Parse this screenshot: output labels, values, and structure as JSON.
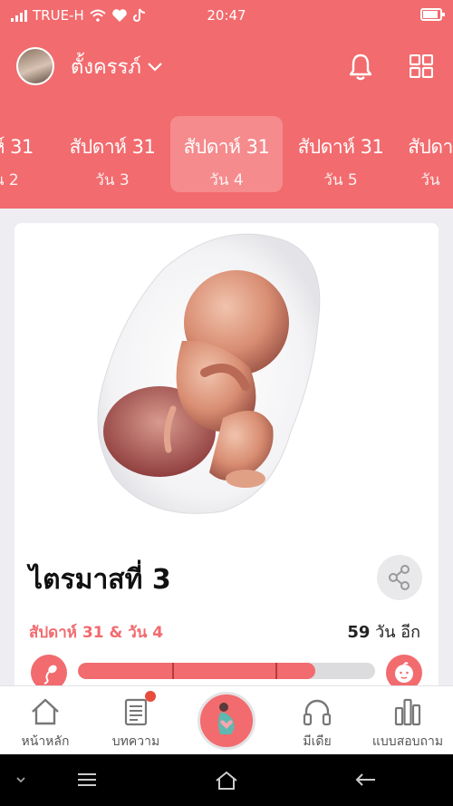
{
  "status_bar": {
    "carrier": "TRUE-H",
    "time": "20:47"
  },
  "header": {
    "username": "ตั้งครรภ์"
  },
  "week_strip": [
    {
      "week": "ดาห์ 31",
      "day": "วัน 2"
    },
    {
      "week": "สัปดาห์ 31",
      "day": "วัน 3"
    },
    {
      "week": "สัปดาห์ 31",
      "day": "วัน 4",
      "active": true
    },
    {
      "week": "สัปดาห์ 31",
      "day": "วัน 5"
    },
    {
      "week": "สัปดา",
      "day": "วัน"
    }
  ],
  "card": {
    "title": "ไตรมาสที่ 3",
    "week_day": "สัปดาห์ 31 & วัน 4",
    "days_left_number": "59",
    "days_left_text": "วัน อีก",
    "progress_fraction": 0.8
  },
  "bottom_nav": [
    {
      "label": "หน้าหลัก",
      "icon": "home-icon"
    },
    {
      "label": "บทความ",
      "icon": "article-icon"
    },
    {
      "label": "",
      "icon": "pregnancy-icon"
    },
    {
      "label": "มีเดีย",
      "icon": "headphones-icon"
    },
    {
      "label": "แบบสอบถาม",
      "icon": "bar-chart-icon"
    }
  ],
  "colors": {
    "accent": "#f26b6e",
    "background": "#eeeef2"
  }
}
